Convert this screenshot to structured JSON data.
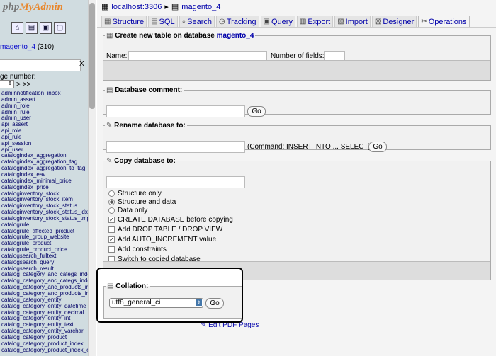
{
  "nav": {
    "logo_part1": "php",
    "logo_part2": "MyAdmin",
    "db_name": "magento_4",
    "db_count": "(310)",
    "filter_clear": "X",
    "page_label": "ge number:",
    "page_next": "> >>",
    "tables": [
      "adminnotification_inbox",
      "admin_assert",
      "admin_role",
      "admin_rule",
      "admin_user",
      "api_assert",
      "api_role",
      "api_rule",
      "api_session",
      "api_user",
      "catalogindex_aggregation",
      "catalogindex_aggregation_tag",
      "catalogindex_aggregation_to_tag",
      "catalogindex_eav",
      "catalogindex_minimal_price",
      "catalogindex_price",
      "cataloginventory_stock",
      "cataloginventory_stock_item",
      "cataloginventory_stock_status",
      "cataloginventory_stock_status_idx",
      "cataloginventory_stock_status_tmp",
      "catalogrule",
      "catalogrule_affected_product",
      "catalogrule_group_website",
      "catalogrule_product",
      "catalogrule_product_price",
      "catalogsearch_fulltext",
      "catalogsearch_query",
      "catalogsearch_result",
      "catalog_category_anc_categs_inde",
      "catalog_category_anc_categs_inde",
      "catalog_category_anc_products_in",
      "catalog_category_anc_products_in",
      "catalog_category_entity",
      "catalog_category_entity_datetime",
      "catalog_category_entity_decimal",
      "catalog_category_entity_int",
      "catalog_category_entity_text",
      "catalog_category_entity_varchar",
      "catalog_category_product",
      "catalog_category_product_index",
      "catalog_category_product_index_e"
    ]
  },
  "breadcrumb": {
    "server": "localhost:3306",
    "database": "magento_4"
  },
  "tabs": [
    {
      "label": "Structure",
      "icon": "▦"
    },
    {
      "label": "SQL",
      "icon": "▤"
    },
    {
      "label": "Search",
      "icon": "⌕"
    },
    {
      "label": "Tracking",
      "icon": "◷"
    },
    {
      "label": "Query",
      "icon": "▣"
    },
    {
      "label": "Export",
      "icon": "▥"
    },
    {
      "label": "Import",
      "icon": "▧"
    },
    {
      "label": "Designer",
      "icon": "▨"
    },
    {
      "label": "Operations",
      "icon": "✂"
    }
  ],
  "create_table": {
    "legend": "Create new table on database",
    "db": "magento_4",
    "name_label": "Name:",
    "fields_label": "Number of fields:"
  },
  "comment": {
    "legend": "Database comment:",
    "go": "Go"
  },
  "rename": {
    "legend": "Rename database to:",
    "note": "(Command: INSERT INTO ... SELECT)",
    "go": "Go"
  },
  "copy": {
    "legend": "Copy database to:",
    "options": [
      {
        "label": "Structure only"
      },
      {
        "label": "Structure and data"
      },
      {
        "label": "Data only"
      },
      {
        "label": "CREATE DATABASE before copying"
      },
      {
        "label": "Add DROP TABLE / DROP VIEW"
      },
      {
        "label": "Add AUTO_INCREMENT value"
      },
      {
        "label": "Add constraints"
      },
      {
        "label": "Switch to copied database"
      }
    ]
  },
  "collation": {
    "legend": "Collation:",
    "value": "utf8_general_ci",
    "go": "Go"
  },
  "pdf_link": "Edit PDF Pages"
}
